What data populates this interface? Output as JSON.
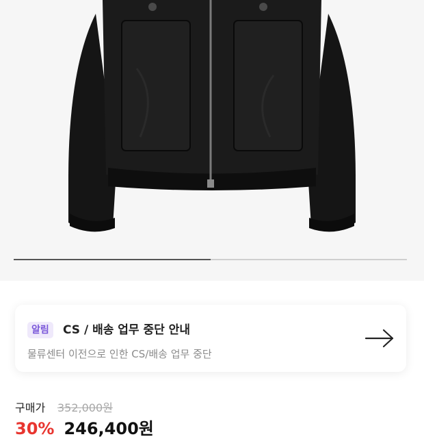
{
  "product_image": {
    "alt": "black zip-up jacket",
    "image_index": 1,
    "image_count": 2
  },
  "notice": {
    "badge": "알림",
    "title": "CS / 배송 업무 중단 안내",
    "subtitle": "물류센터 이전으로 인한 CS/배송 업무 중단",
    "arrow_icon": "arrow-right-icon"
  },
  "price": {
    "label": "구매가",
    "original": "352,000원",
    "discount": "30%",
    "sale": "246,400원"
  },
  "colors": {
    "badge_bg": "#efe9fb",
    "badge_text": "#7a57d9",
    "discount": "#e8352f",
    "strike": "#a8a8a8"
  }
}
